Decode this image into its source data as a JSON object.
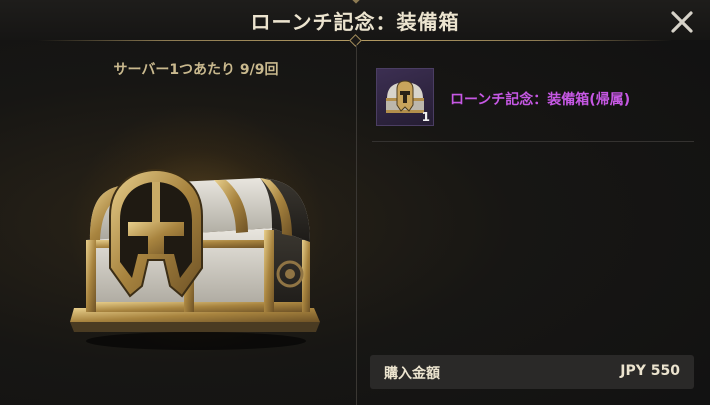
{
  "dialog": {
    "title": "ローンチ記念：装備箱",
    "close_icon": "close-x-icon"
  },
  "left_panel": {
    "purchase_limit": "サーバー1つあたり 9/9回",
    "chest_image": "helmet-emblem-treasure-chest"
  },
  "item": {
    "icon": "helmet-chest-icon",
    "quantity": "1",
    "name": "ローンチ記念：装備箱(帰属)",
    "name_color": "#c658e4"
  },
  "price": {
    "label": "購入金額",
    "value": "JPY 550"
  },
  "colors": {
    "title_text": "#ece4cf",
    "accent_gold": "#b49b62",
    "limit_text": "#c9b98e"
  }
}
